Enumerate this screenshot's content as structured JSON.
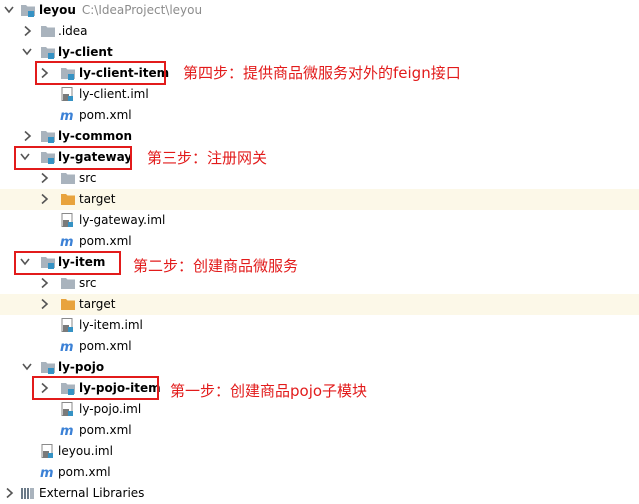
{
  "tree": {
    "root": {
      "name": "leyou",
      "path": "C:\\IdeaProject\\leyou"
    },
    "idea": ".idea",
    "ly_client": {
      "name": "ly-client",
      "item": "ly-client-item",
      "iml": "ly-client.iml",
      "pom": "pom.xml"
    },
    "ly_common": "ly-common",
    "ly_gateway": {
      "name": "ly-gateway",
      "src": "src",
      "target": "target",
      "iml": "ly-gateway.iml",
      "pom": "pom.xml"
    },
    "ly_item": {
      "name": "ly-item",
      "src": "src",
      "target": "target",
      "iml": "ly-item.iml",
      "pom": "pom.xml"
    },
    "ly_pojo": {
      "name": "ly-pojo",
      "item": "ly-pojo-item",
      "iml": "ly-pojo.iml",
      "pom": "pom.xml"
    },
    "root_iml": "leyou.iml",
    "root_pom": "pom.xml",
    "external_libraries": "External Libraries"
  },
  "annotations": {
    "step4": "第四步：提供商品微服务对外的feign接口",
    "step3": "第三步：注册网关",
    "step2": "第二步：创建商品微服务",
    "step1": "第一步：创建商品pojo子模块"
  },
  "colors": {
    "annotation_red": "#e21b1b",
    "folder_gray": "#a9b3bd",
    "module_blue": "#3592c4",
    "target_orange": "#e8a33d",
    "pom_blue": "#3b81d6",
    "highlight_row": "#fcf8e8"
  },
  "icons": {
    "expanded": "chevron-down-icon",
    "collapsed": "chevron-right-icon",
    "module": "module-folder-icon",
    "folder": "folder-icon",
    "target": "excluded-folder-icon",
    "iml": "iml-file-icon",
    "pom": "maven-pom-icon",
    "libraries": "external-libraries-icon"
  }
}
